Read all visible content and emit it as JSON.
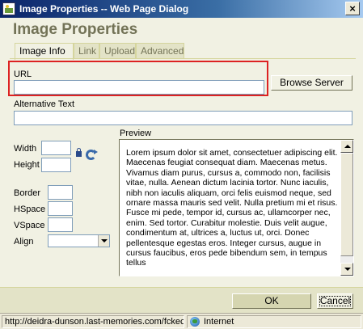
{
  "window": {
    "title": "Image Properties -- Web Page Dialog",
    "close_glyph": "×"
  },
  "dialog": {
    "heading": "Image Properties",
    "tabs": [
      {
        "label": "Image Info"
      },
      {
        "label": "Link"
      },
      {
        "label": "Upload"
      },
      {
        "label": "Advanced"
      }
    ]
  },
  "form": {
    "url_label": "URL",
    "url_value": "",
    "browse_label": "Browse Server",
    "alt_label": "Alternative Text",
    "alt_value": "",
    "width_label": "Width",
    "height_label": "Height",
    "border_label": "Border",
    "hspace_label": "HSpace",
    "vspace_label": "VSpace",
    "align_label": "Align",
    "align_value": ""
  },
  "preview": {
    "label": "Preview",
    "text": "Lorem ipsum dolor sit amet, consectetuer adipiscing elit. Maecenas feugiat consequat diam. Maecenas metus. Vivamus diam purus, cursus a, commodo non, facilisis vitae, nulla. Aenean dictum lacinia tortor. Nunc iaculis, nibh non iaculis aliquam, orci felis euismod neque, sed ornare massa mauris sed velit. Nulla pretium mi et risus. Fusce mi pede, tempor id, cursus ac, ullamcorper nec, enim. Sed tortor. Curabitur molestie. Duis velit augue, condimentum at, ultrices a, luctus ut, orci. Donec pellentesque egestas eros. Integer cursus, augue in cursus faucibus, eros pede bibendum sem, in tempus tellus"
  },
  "buttons": {
    "ok": "OK",
    "cancel": "Cancel"
  },
  "statusbar": {
    "url": "http://deidra-dunson.last-memories.com/fckec",
    "zone": "Internet"
  },
  "colors": {
    "dialog_bg": "#f1f1e3",
    "heading": "#737357",
    "highlight": "#dd2222",
    "titlebar": "#0a246a"
  }
}
